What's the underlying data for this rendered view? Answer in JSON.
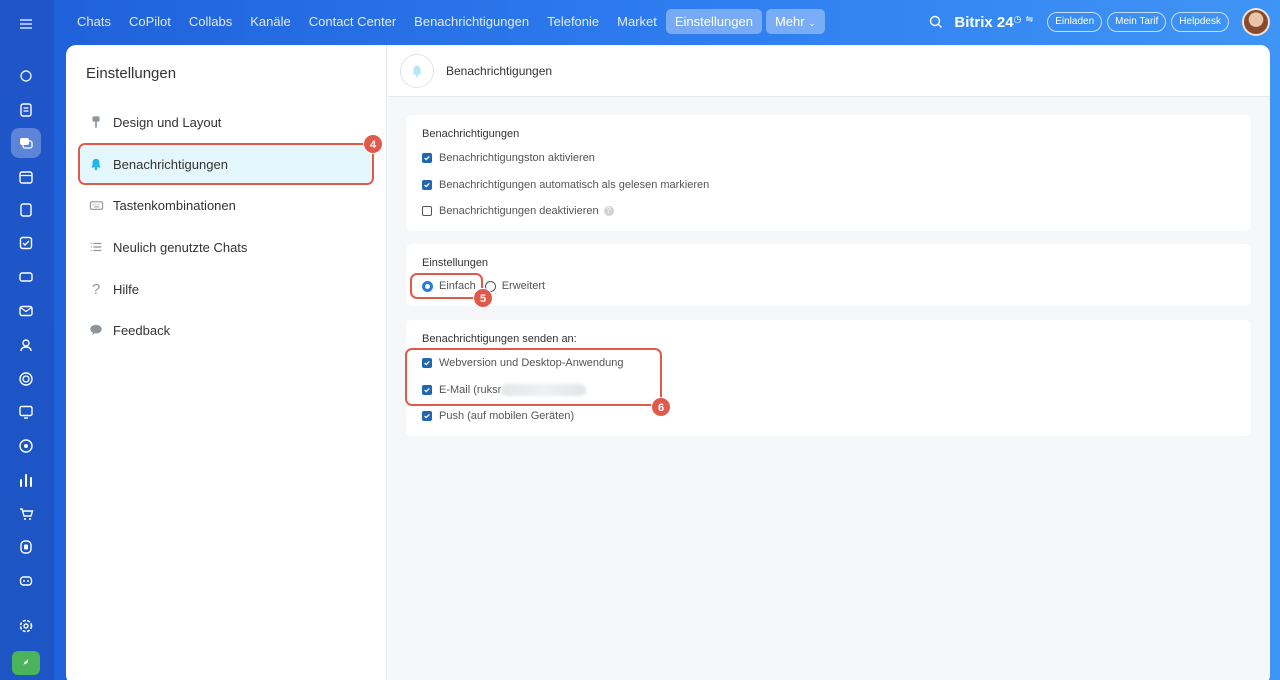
{
  "topnav": {
    "items": [
      "Chats",
      "CoPilot",
      "Collabs",
      "Kanäle",
      "Contact Center",
      "Benachrichtigungen",
      "Telefonie",
      "Market",
      "Einstellungen"
    ],
    "active": "Einstellungen",
    "more_label": "Mehr",
    "brand": "Bitrix 24",
    "buttons": [
      "Einladen",
      "Mein Tarif",
      "Helpdesk"
    ]
  },
  "sidebar": {
    "title": "Einstellungen",
    "items": [
      {
        "label": "Design und Layout",
        "icon": "brush-icon"
      },
      {
        "label": "Benachrichtigungen",
        "icon": "bell-icon"
      },
      {
        "label": "Tastenkombinationen",
        "icon": "keyboard-icon"
      },
      {
        "label": "Neulich genutzte Chats",
        "icon": "list-icon"
      },
      {
        "label": "Hilfe",
        "icon": "question-icon"
      },
      {
        "label": "Feedback",
        "icon": "speech-bubble-icon"
      }
    ]
  },
  "content": {
    "header_title": "Benachrichtigungen",
    "notifications": {
      "title": "Benachrichtigungen",
      "options": [
        {
          "label": "Benachrichtigungston aktivieren",
          "checked": true
        },
        {
          "label": "Benachrichtigungen automatisch als gelesen markieren",
          "checked": true
        },
        {
          "label": "Benachrichtigungen deaktivieren",
          "checked": false
        }
      ]
    },
    "settings": {
      "title": "Einstellungen",
      "modes": [
        {
          "label": "Einfach",
          "selected": true
        },
        {
          "label": "Erweitert",
          "selected": false
        }
      ]
    },
    "send_to": {
      "title": "Benachrichtigungen senden an:",
      "options": [
        {
          "label": "Webversion und Desktop-Anwendung",
          "checked": true
        },
        {
          "label": "E-Mail (ruksr",
          "checked": true
        },
        {
          "label": "Push (auf mobilen Geräten)",
          "checked": true
        }
      ]
    }
  },
  "callouts": {
    "step4": "4",
    "step5": "5",
    "step6": "6"
  },
  "colors": {
    "accent_highlight": "#e05a4b",
    "checkbox": "#2067b0",
    "topbar": "#2f7df0"
  }
}
